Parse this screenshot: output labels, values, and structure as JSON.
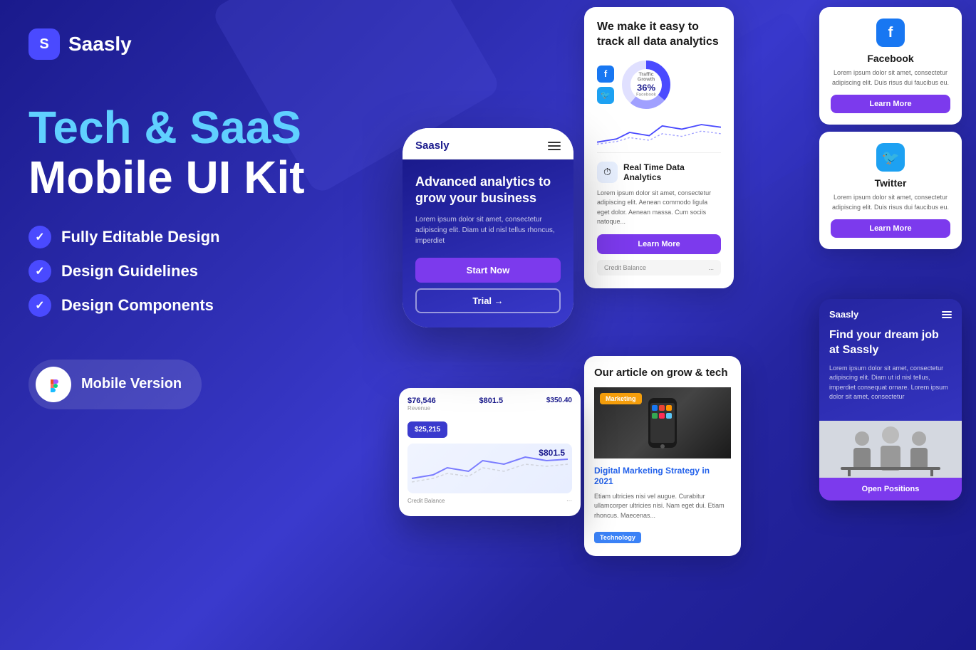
{
  "meta": {
    "title": "Tech & SaaS Mobile UI Kit",
    "bg_color_start": "#1a1a8c",
    "bg_color_end": "#3a3acd"
  },
  "logo": {
    "icon_letter": "S",
    "name": "Saasly"
  },
  "hero": {
    "title_line1": "Tech & SaaS",
    "title_line2": "Mobile UI Kit",
    "features": [
      "Fully Editable Design",
      "Design Guidelines",
      "Design Components"
    ]
  },
  "figma_badge": {
    "icon": "◆",
    "label": "Mobile Version"
  },
  "phone": {
    "logo": "Saasly",
    "hero_title": "Advanced analytics to grow your business",
    "hero_desc": "Lorem ipsum dolor sit amet, consectetur adipiscing elit. Diam ut id nisl tellus rhoncus, imperdiet",
    "btn_primary": "Start Now",
    "btn_secondary": "Trial →"
  },
  "analytics_card": {
    "title": "We make it easy to track all data analytics",
    "chart_label": "Traffic Growth",
    "chart_percent": "36%",
    "fb_label": "f",
    "tw_label": "🐦",
    "realtime_title": "Real Time Data Analytics",
    "realtime_desc": "Lorem ipsum dolor sit amet, consectetur adipiscing elit. Aenean commodo ligula eget dolor. Aenean massa. Cum sociis natoque...",
    "learn_more": "Learn More",
    "credit_label": "Credit Balance",
    "credit_dots": "..."
  },
  "social_cards": [
    {
      "icon": "f",
      "bg": "fb",
      "name": "Facebook",
      "desc": "Lorem ipsum dolor sit amet, consectetur adipiscing elit. Duis risus dui faucibus eu.",
      "btn": "Learn More"
    },
    {
      "icon": "🐦",
      "bg": "tw",
      "name": "Twitter",
      "desc": "Lorem ipsum dolor sit amet, consectetur adipiscing elit. Duis risus dui faucibus eu.",
      "btn": "Learn More"
    }
  ],
  "article_card": {
    "section_title": "Our article on grow & tech",
    "badge": "Marketing",
    "post_title": "Digital Marketing Strategy in 2021",
    "post_desc": "Etiam ultricies nisi vel augue. Curabitur ullamcorper ultricies nisi. Nam eget dui. Etiam rhoncus. Maecenas...",
    "tech_badge": "Technology"
  },
  "job_card": {
    "logo": "Saasly",
    "title": "Find your dream job at Sassly",
    "desc": "Lorem ipsum dolor sit amet, consectetur adipiscing elit. Diam ut id nisl tellus, imperdiet consequat ornare. Lorem ipsum dolor sit amet, consectetur",
    "btn": "Open Positions"
  },
  "dashboard": {
    "stat1_label": "$76,546",
    "stat2_label": "$801.5",
    "stat3_label": "$350.40",
    "balance_label": "$25,215",
    "main_value": "$801.5",
    "credit_label": "Credit Balance"
  }
}
